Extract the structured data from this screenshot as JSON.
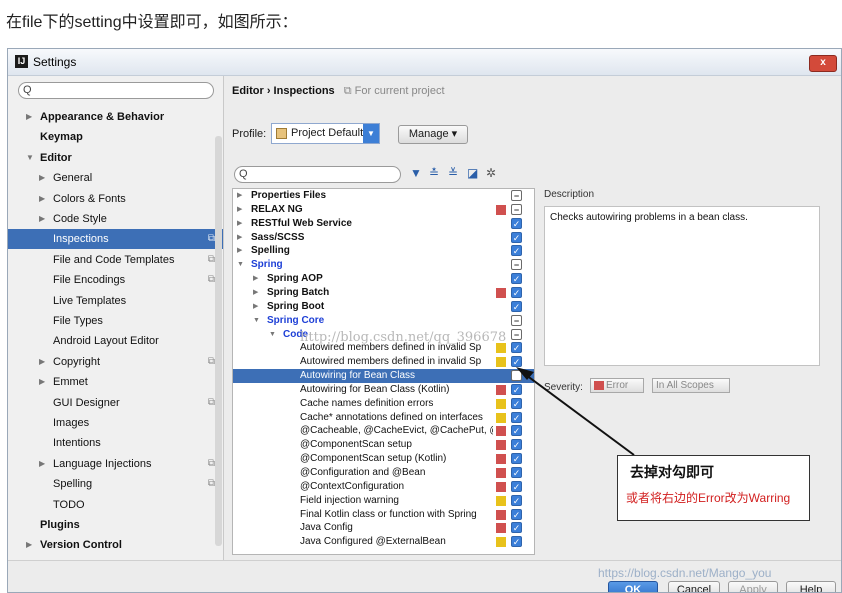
{
  "caption": "在file下的setting中设置即可，如图所示：",
  "window": {
    "title": "Settings",
    "close_label": "x"
  },
  "left": {
    "search_icon": "Q",
    "items": [
      {
        "label": "Appearance & Behavior",
        "arrow": "▶",
        "bold": true,
        "level": 0
      },
      {
        "label": "Keymap",
        "arrow": "",
        "bold": true,
        "level": 0
      },
      {
        "label": "Editor",
        "arrow": "▼",
        "bold": true,
        "level": 0
      },
      {
        "label": "General",
        "arrow": "▶",
        "bold": false,
        "level": 1
      },
      {
        "label": "Colors & Fonts",
        "arrow": "▶",
        "bold": false,
        "level": 1
      },
      {
        "label": "Code Style",
        "arrow": "▶",
        "bold": false,
        "level": 1
      },
      {
        "label": "Inspections",
        "arrow": "",
        "bold": false,
        "level": 1,
        "selected": true,
        "project": true
      },
      {
        "label": "File and Code Templates",
        "arrow": "",
        "bold": false,
        "level": 1,
        "project": true
      },
      {
        "label": "File Encodings",
        "arrow": "",
        "bold": false,
        "level": 1,
        "project": true
      },
      {
        "label": "Live Templates",
        "arrow": "",
        "bold": false,
        "level": 1
      },
      {
        "label": "File Types",
        "arrow": "",
        "bold": false,
        "level": 1
      },
      {
        "label": "Android Layout Editor",
        "arrow": "",
        "bold": false,
        "level": 1
      },
      {
        "label": "Copyright",
        "arrow": "▶",
        "bold": false,
        "level": 1,
        "project": true
      },
      {
        "label": "Emmet",
        "arrow": "▶",
        "bold": false,
        "level": 1
      },
      {
        "label": "GUI Designer",
        "arrow": "",
        "bold": false,
        "level": 1,
        "project": true
      },
      {
        "label": "Images",
        "arrow": "",
        "bold": false,
        "level": 1
      },
      {
        "label": "Intentions",
        "arrow": "",
        "bold": false,
        "level": 1
      },
      {
        "label": "Language Injections",
        "arrow": "▶",
        "bold": false,
        "level": 1,
        "project": true
      },
      {
        "label": "Spelling",
        "arrow": "",
        "bold": false,
        "level": 1,
        "project": true
      },
      {
        "label": "TODO",
        "arrow": "",
        "bold": false,
        "level": 1
      },
      {
        "label": "Plugins",
        "arrow": "",
        "bold": true,
        "level": 0
      },
      {
        "label": "Version Control",
        "arrow": "▶",
        "bold": true,
        "level": 0
      }
    ]
  },
  "right": {
    "breadcrumb": "Editor › Inspections",
    "breadcrumb_note": "⧉ For current project",
    "profile_label": "Profile:",
    "profile_value": "Project Default",
    "manage_label": "Manage ▾",
    "filter_icon": "Q",
    "description_title": "Description",
    "description_text": "Checks autowiring problems in a bean class.",
    "severity_label": "Severity:",
    "severity_value": "Error",
    "scope_value": "In All Scopes",
    "inspections": [
      {
        "label": "Properties Files",
        "level": 0,
        "arrow": "▶",
        "bold": true,
        "cb": "part"
      },
      {
        "label": "RELAX NG",
        "level": 0,
        "arrow": "▶",
        "bold": true,
        "sev": "#d0504f",
        "cb": "part"
      },
      {
        "label": "RESTful Web Service",
        "level": 0,
        "arrow": "▶",
        "bold": true,
        "cb": "on"
      },
      {
        "label": "Sass/SCSS",
        "level": 0,
        "arrow": "▶",
        "bold": true,
        "cb": "on"
      },
      {
        "label": "Spelling",
        "level": 0,
        "arrow": "▶",
        "bold": true,
        "cb": "on"
      },
      {
        "label": "Spring",
        "level": 0,
        "arrow": "▼",
        "bold": true,
        "blue": true,
        "cb": "part"
      },
      {
        "label": "Spring AOP",
        "level": 1,
        "arrow": "▶",
        "bold": true,
        "cb": "on"
      },
      {
        "label": "Spring Batch",
        "level": 1,
        "arrow": "▶",
        "bold": true,
        "sev": "#d0504f",
        "cb": "on"
      },
      {
        "label": "Spring Boot",
        "level": 1,
        "arrow": "▶",
        "bold": true,
        "cb": "on"
      },
      {
        "label": "Spring Core",
        "level": 1,
        "arrow": "▼",
        "bold": true,
        "blue": true,
        "cb": "part"
      },
      {
        "label": "Code",
        "level": 2,
        "arrow": "▼",
        "bold": true,
        "blue": true,
        "cb": "part"
      },
      {
        "label": "Autowired members defined in invalid Sp",
        "level": 3,
        "sev": "#e8c21b",
        "cb": "on"
      },
      {
        "label": "Autowired members defined in invalid Sp",
        "level": 3,
        "sev": "#e8c21b",
        "cb": "on"
      },
      {
        "label": "Autowiring for Bean Class",
        "level": 3,
        "selected": true,
        "cb": "off"
      },
      {
        "label": "Autowiring for Bean Class (Kotlin)",
        "level": 3,
        "sev": "#d0504f",
        "cb": "on"
      },
      {
        "label": "Cache names definition errors",
        "level": 3,
        "sev": "#e8c21b",
        "cb": "on"
      },
      {
        "label": "Cache* annotations defined on interfaces",
        "level": 3,
        "sev": "#e8c21b",
        "cb": "on"
      },
      {
        "label": "@Cacheable, @CacheEvict, @CachePut, @",
        "level": 3,
        "sev": "#d0504f",
        "cb": "on"
      },
      {
        "label": "@ComponentScan setup",
        "level": 3,
        "sev": "#d0504f",
        "cb": "on"
      },
      {
        "label": "@ComponentScan setup (Kotlin)",
        "level": 3,
        "sev": "#d0504f",
        "cb": "on"
      },
      {
        "label": "@Configuration and @Bean",
        "level": 3,
        "sev": "#d0504f",
        "cb": "on"
      },
      {
        "label": "@ContextConfiguration",
        "level": 3,
        "sev": "#d0504f",
        "cb": "on"
      },
      {
        "label": "Field injection warning",
        "level": 3,
        "sev": "#e8c21b",
        "cb": "on"
      },
      {
        "label": "Final Kotlin class or function with Spring",
        "level": 3,
        "sev": "#d0504f",
        "cb": "on"
      },
      {
        "label": "Java Config",
        "level": 3,
        "sev": "#d0504f",
        "cb": "on"
      },
      {
        "label": "Java Configured @ExternalBean",
        "level": 3,
        "sev": "#e8c21b",
        "cb": "on"
      }
    ]
  },
  "buttons": {
    "ok": "OK",
    "cancel": "Cancel",
    "apply": "Apply",
    "help": "Help"
  },
  "watermarks": {
    "middle": "http://blog.csdn.net/qq_396678",
    "bottom": "https://blog.csdn.net/Mango_you"
  },
  "annotation": {
    "title": "去掉对勾即可",
    "subtitle": "或者将右边的Error改为Warring"
  }
}
